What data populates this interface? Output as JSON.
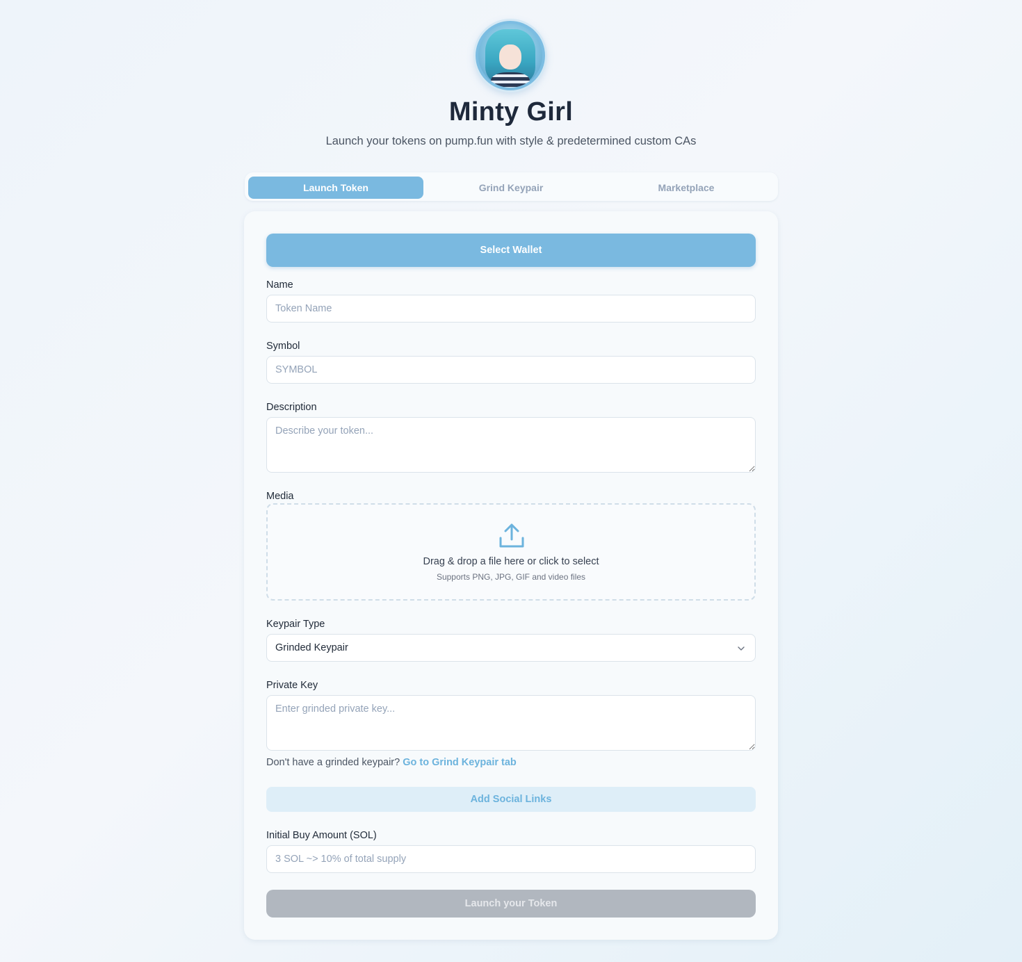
{
  "header": {
    "title": "Minty Girl",
    "subtitle": "Launch your tokens on pump.fun with style & predetermined custom CAs"
  },
  "tabs": [
    {
      "label": "Launch Token",
      "active": true
    },
    {
      "label": "Grind Keypair",
      "active": false
    },
    {
      "label": "Marketplace",
      "active": false
    }
  ],
  "form": {
    "select_wallet_label": "Select Wallet",
    "name": {
      "label": "Name",
      "placeholder": "Token Name",
      "value": ""
    },
    "symbol": {
      "label": "Symbol",
      "placeholder": "SYMBOL",
      "value": ""
    },
    "description": {
      "label": "Description",
      "placeholder": "Describe your token...",
      "value": ""
    },
    "media": {
      "label": "Media",
      "drop_text": "Drag & drop a file here or click to select",
      "support_text": "Supports PNG, JPG, GIF and video files"
    },
    "keypair_type": {
      "label": "Keypair Type",
      "value": "Grinded Keypair"
    },
    "private_key": {
      "label": "Private Key",
      "placeholder": "Enter grinded private key...",
      "value": ""
    },
    "hint": {
      "text": "Don't have a grinded keypair?",
      "link": "Go to Grind Keypair tab"
    },
    "social_links_label": "Add Social Links",
    "initial_buy": {
      "label": "Initial Buy Amount (SOL)",
      "placeholder": "3 SOL ~> 10% of total supply",
      "value": ""
    },
    "launch_label": "Launch your Token"
  },
  "colors": {
    "accent": "#7ab9e0",
    "link": "#6cb3dd",
    "disabled_button": "#b1b7bf",
    "title": "#1e293b"
  },
  "icons": {
    "avatar": "avatar-image",
    "upload": "upload-icon",
    "select_chevron": "chevron-down-icon"
  }
}
